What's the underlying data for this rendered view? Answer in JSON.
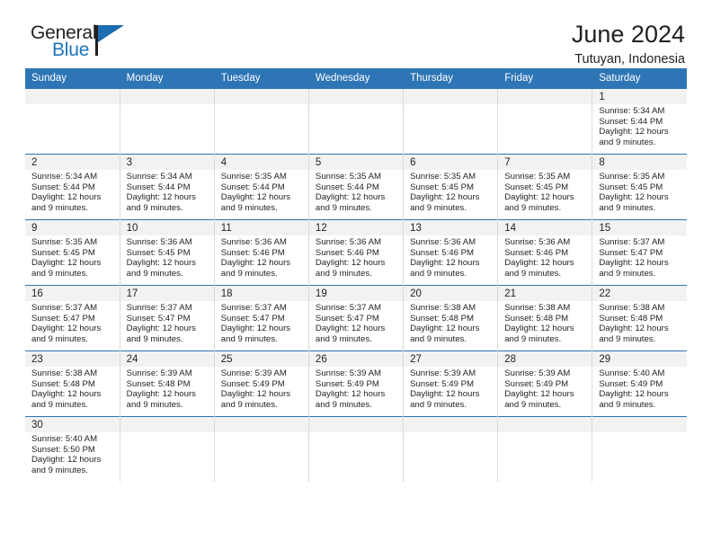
{
  "logo": {
    "word_one": "General",
    "word_two": "Blue",
    "flag_icon": "blue-flag-triangle-icon"
  },
  "header": {
    "title": "June 2024",
    "location": "Tutuyan, Indonesia"
  },
  "colors": {
    "header_blue": "#2e75b6",
    "logo_blue": "#1b75bb",
    "daynum_band": "#f2f2f2",
    "cell_divider": "#d9d9d9",
    "text": "#231f20"
  },
  "calendar": {
    "weekday_headers": [
      "Sunday",
      "Monday",
      "Tuesday",
      "Wednesday",
      "Thursday",
      "Friday",
      "Saturday"
    ],
    "labels": {
      "sunrise": "Sunrise:",
      "sunset": "Sunset:",
      "daylight": "Daylight:"
    },
    "weeks": [
      [
        {
          "day": "",
          "sunrise": "",
          "sunset": "",
          "daylight": "",
          "empty": true
        },
        {
          "day": "",
          "sunrise": "",
          "sunset": "",
          "daylight": "",
          "empty": true
        },
        {
          "day": "",
          "sunrise": "",
          "sunset": "",
          "daylight": "",
          "empty": true
        },
        {
          "day": "",
          "sunrise": "",
          "sunset": "",
          "daylight": "",
          "empty": true
        },
        {
          "day": "",
          "sunrise": "",
          "sunset": "",
          "daylight": "",
          "empty": true
        },
        {
          "day": "",
          "sunrise": "",
          "sunset": "",
          "daylight": "",
          "empty": true
        },
        {
          "day": "1",
          "sunrise": "Sunrise: 5:34 AM",
          "sunset": "Sunset: 5:44 PM",
          "daylight": "Daylight: 12 hours and 9 minutes.",
          "empty": false
        }
      ],
      [
        {
          "day": "2",
          "sunrise": "Sunrise: 5:34 AM",
          "sunset": "Sunset: 5:44 PM",
          "daylight": "Daylight: 12 hours and 9 minutes.",
          "empty": false
        },
        {
          "day": "3",
          "sunrise": "Sunrise: 5:34 AM",
          "sunset": "Sunset: 5:44 PM",
          "daylight": "Daylight: 12 hours and 9 minutes.",
          "empty": false
        },
        {
          "day": "4",
          "sunrise": "Sunrise: 5:35 AM",
          "sunset": "Sunset: 5:44 PM",
          "daylight": "Daylight: 12 hours and 9 minutes.",
          "empty": false
        },
        {
          "day": "5",
          "sunrise": "Sunrise: 5:35 AM",
          "sunset": "Sunset: 5:44 PM",
          "daylight": "Daylight: 12 hours and 9 minutes.",
          "empty": false
        },
        {
          "day": "6",
          "sunrise": "Sunrise: 5:35 AM",
          "sunset": "Sunset: 5:45 PM",
          "daylight": "Daylight: 12 hours and 9 minutes.",
          "empty": false
        },
        {
          "day": "7",
          "sunrise": "Sunrise: 5:35 AM",
          "sunset": "Sunset: 5:45 PM",
          "daylight": "Daylight: 12 hours and 9 minutes.",
          "empty": false
        },
        {
          "day": "8",
          "sunrise": "Sunrise: 5:35 AM",
          "sunset": "Sunset: 5:45 PM",
          "daylight": "Daylight: 12 hours and 9 minutes.",
          "empty": false
        }
      ],
      [
        {
          "day": "9",
          "sunrise": "Sunrise: 5:35 AM",
          "sunset": "Sunset: 5:45 PM",
          "daylight": "Daylight: 12 hours and 9 minutes.",
          "empty": false
        },
        {
          "day": "10",
          "sunrise": "Sunrise: 5:36 AM",
          "sunset": "Sunset: 5:45 PM",
          "daylight": "Daylight: 12 hours and 9 minutes.",
          "empty": false
        },
        {
          "day": "11",
          "sunrise": "Sunrise: 5:36 AM",
          "sunset": "Sunset: 5:46 PM",
          "daylight": "Daylight: 12 hours and 9 minutes.",
          "empty": false
        },
        {
          "day": "12",
          "sunrise": "Sunrise: 5:36 AM",
          "sunset": "Sunset: 5:46 PM",
          "daylight": "Daylight: 12 hours and 9 minutes.",
          "empty": false
        },
        {
          "day": "13",
          "sunrise": "Sunrise: 5:36 AM",
          "sunset": "Sunset: 5:46 PM",
          "daylight": "Daylight: 12 hours and 9 minutes.",
          "empty": false
        },
        {
          "day": "14",
          "sunrise": "Sunrise: 5:36 AM",
          "sunset": "Sunset: 5:46 PM",
          "daylight": "Daylight: 12 hours and 9 minutes.",
          "empty": false
        },
        {
          "day": "15",
          "sunrise": "Sunrise: 5:37 AM",
          "sunset": "Sunset: 5:47 PM",
          "daylight": "Daylight: 12 hours and 9 minutes.",
          "empty": false
        }
      ],
      [
        {
          "day": "16",
          "sunrise": "Sunrise: 5:37 AM",
          "sunset": "Sunset: 5:47 PM",
          "daylight": "Daylight: 12 hours and 9 minutes.",
          "empty": false
        },
        {
          "day": "17",
          "sunrise": "Sunrise: 5:37 AM",
          "sunset": "Sunset: 5:47 PM",
          "daylight": "Daylight: 12 hours and 9 minutes.",
          "empty": false
        },
        {
          "day": "18",
          "sunrise": "Sunrise: 5:37 AM",
          "sunset": "Sunset: 5:47 PM",
          "daylight": "Daylight: 12 hours and 9 minutes.",
          "empty": false
        },
        {
          "day": "19",
          "sunrise": "Sunrise: 5:37 AM",
          "sunset": "Sunset: 5:47 PM",
          "daylight": "Daylight: 12 hours and 9 minutes.",
          "empty": false
        },
        {
          "day": "20",
          "sunrise": "Sunrise: 5:38 AM",
          "sunset": "Sunset: 5:48 PM",
          "daylight": "Daylight: 12 hours and 9 minutes.",
          "empty": false
        },
        {
          "day": "21",
          "sunrise": "Sunrise: 5:38 AM",
          "sunset": "Sunset: 5:48 PM",
          "daylight": "Daylight: 12 hours and 9 minutes.",
          "empty": false
        },
        {
          "day": "22",
          "sunrise": "Sunrise: 5:38 AM",
          "sunset": "Sunset: 5:48 PM",
          "daylight": "Daylight: 12 hours and 9 minutes.",
          "empty": false
        }
      ],
      [
        {
          "day": "23",
          "sunrise": "Sunrise: 5:38 AM",
          "sunset": "Sunset: 5:48 PM",
          "daylight": "Daylight: 12 hours and 9 minutes.",
          "empty": false
        },
        {
          "day": "24",
          "sunrise": "Sunrise: 5:39 AM",
          "sunset": "Sunset: 5:48 PM",
          "daylight": "Daylight: 12 hours and 9 minutes.",
          "empty": false
        },
        {
          "day": "25",
          "sunrise": "Sunrise: 5:39 AM",
          "sunset": "Sunset: 5:49 PM",
          "daylight": "Daylight: 12 hours and 9 minutes.",
          "empty": false
        },
        {
          "day": "26",
          "sunrise": "Sunrise: 5:39 AM",
          "sunset": "Sunset: 5:49 PM",
          "daylight": "Daylight: 12 hours and 9 minutes.",
          "empty": false
        },
        {
          "day": "27",
          "sunrise": "Sunrise: 5:39 AM",
          "sunset": "Sunset: 5:49 PM",
          "daylight": "Daylight: 12 hours and 9 minutes.",
          "empty": false
        },
        {
          "day": "28",
          "sunrise": "Sunrise: 5:39 AM",
          "sunset": "Sunset: 5:49 PM",
          "daylight": "Daylight: 12 hours and 9 minutes.",
          "empty": false
        },
        {
          "day": "29",
          "sunrise": "Sunrise: 5:40 AM",
          "sunset": "Sunset: 5:49 PM",
          "daylight": "Daylight: 12 hours and 9 minutes.",
          "empty": false
        }
      ],
      [
        {
          "day": "30",
          "sunrise": "Sunrise: 5:40 AM",
          "sunset": "Sunset: 5:50 PM",
          "daylight": "Daylight: 12 hours and 9 minutes.",
          "empty": false
        },
        {
          "day": "",
          "sunrise": "",
          "sunset": "",
          "daylight": "",
          "empty": true
        },
        {
          "day": "",
          "sunrise": "",
          "sunset": "",
          "daylight": "",
          "empty": true
        },
        {
          "day": "",
          "sunrise": "",
          "sunset": "",
          "daylight": "",
          "empty": true
        },
        {
          "day": "",
          "sunrise": "",
          "sunset": "",
          "daylight": "",
          "empty": true
        },
        {
          "day": "",
          "sunrise": "",
          "sunset": "",
          "daylight": "",
          "empty": true
        },
        {
          "day": "",
          "sunrise": "",
          "sunset": "",
          "daylight": "",
          "empty": true
        }
      ]
    ]
  }
}
